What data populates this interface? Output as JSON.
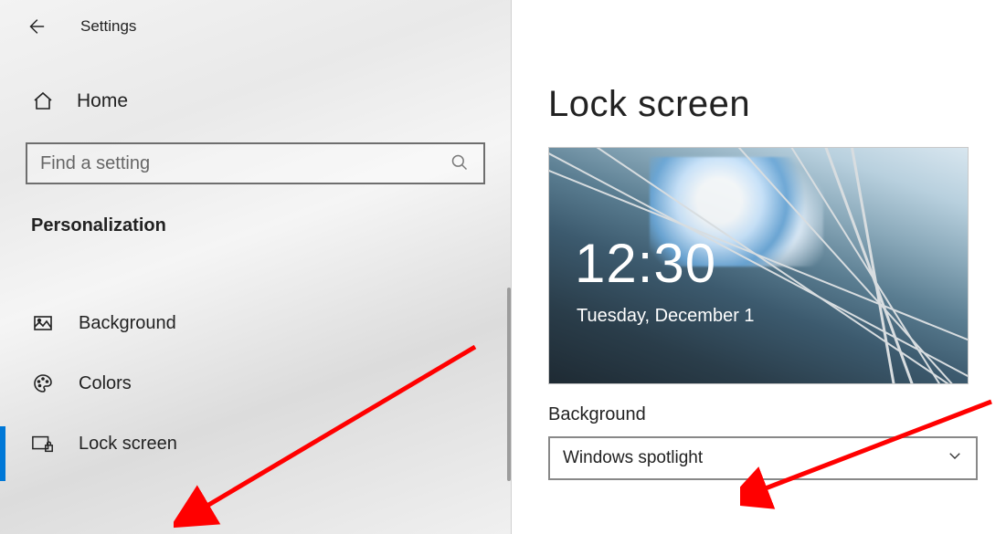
{
  "header": {
    "title": "Settings"
  },
  "sidebar": {
    "home_label": "Home",
    "search_placeholder": "Find a setting",
    "section_heading": "Personalization",
    "items": [
      {
        "label": "Background"
      },
      {
        "label": "Colors"
      },
      {
        "label": "Lock screen"
      }
    ]
  },
  "main": {
    "page_title": "Lock screen",
    "preview_time": "12:30",
    "preview_date": "Tuesday, December 1",
    "background_label": "Background",
    "background_value": "Windows spotlight"
  },
  "annotations": {
    "arrow_color": "#ff0000"
  }
}
